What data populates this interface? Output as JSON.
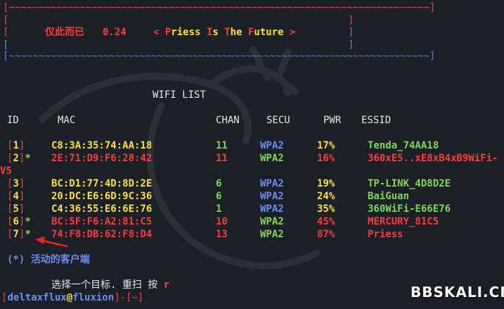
{
  "banner": {
    "top_border": "[~~~~~~~~~~~~~~~~~~~~~~~~~~~~~~~~~~~~~~~~~~~~~~~~~~~~~~~~~~~~~~~~~~~~~~~]",
    "bottom_border": "[~~~~~~~~~~~~~~~~~~~~~~~~~~~~~~~~~~~~~~~~~~~~~~~~~~~~~~~~~~~~~~~~~~~~~~~]",
    "left_bracket": "[",
    "right_bracket": "]",
    "chinese": "仅此而已",
    "version": "0.24",
    "slogan_open": "< ",
    "slogan_P": "P",
    "slogan_riess": "riess ",
    "slogan_I": "I",
    "slogan_s": "s ",
    "slogan_T": "T",
    "slogan_he": "he ",
    "slogan_F": "F",
    "slogan_uture": "uture",
    "slogan_close": " >"
  },
  "wifi_list": {
    "title": "WIFI LIST",
    "headers": {
      "id": "ID",
      "mac": "MAC",
      "chan": "CHAN",
      "secu": "SECU",
      "pwr": "PWR",
      "essid": "ESSID"
    },
    "rows": [
      {
        "id": "1",
        "star": "",
        "mac": "C8:3A:35:74:AA:18",
        "chan": "11",
        "secu": "WPA2",
        "pwr": "17%",
        "essid": "Tenda_74AA18",
        "essid_wrap": ""
      },
      {
        "id": "2",
        "star": "*",
        "mac": "2E:71:D9:F6:28:42",
        "chan": "11",
        "secu": "WPA2",
        "pwr": "16%",
        "essid": "360xE5..xE8xB4xB9WiFi-",
        "essid_wrap": "V5"
      },
      {
        "id": "3",
        "star": "",
        "mac": "BC:D1:77:4D:8D:2E",
        "chan": "6",
        "secu": "WPA2",
        "pwr": "19%",
        "essid": "TP-LINK_4D8D2E",
        "essid_wrap": ""
      },
      {
        "id": "4",
        "star": "",
        "mac": "20:DC:E6:6D:9C:36",
        "chan": "6",
        "secu": "WPA2",
        "pwr": "24%",
        "essid": "BaiGuan",
        "essid_wrap": ""
      },
      {
        "id": "5",
        "star": "",
        "mac": "C4:36:55:E6:6E:76",
        "chan": "1",
        "secu": "WPA2",
        "pwr": "35%",
        "essid": "360WiFi-E66E76",
        "essid_wrap": ""
      },
      {
        "id": "6",
        "star": "*",
        "mac": "BC:5F:F6:A2:81:C5",
        "chan": "10",
        "secu": "WPA2",
        "pwr": "45%",
        "essid": "MERCURY_81C5",
        "essid_wrap": ""
      },
      {
        "id": "7",
        "star": "*",
        "mac": "74:F8:DB:62:F8:D4",
        "chan": "13",
        "secu": "WPA2",
        "pwr": "87%",
        "essid": "Priess",
        "essid_wrap": ""
      }
    ]
  },
  "active_clients_note": "(*) 活动的客户端",
  "prompt_line": {
    "select_text": "选择一个目标. 重扫 按",
    "rescan_key": "r"
  },
  "shell": {
    "open_bracket": "[",
    "user": "deltaxflux",
    "at": "@",
    "host": "fluxion",
    "close_bracket": "]",
    "dash": "-",
    "cwd": "[~]"
  },
  "watermark": "BBSKALI.CN",
  "colors": {
    "background": "#1b1f26",
    "red": "#ff3b3b",
    "yellow": "#ffe03a",
    "green": "#7ed957",
    "blue": "#6d8df0"
  }
}
